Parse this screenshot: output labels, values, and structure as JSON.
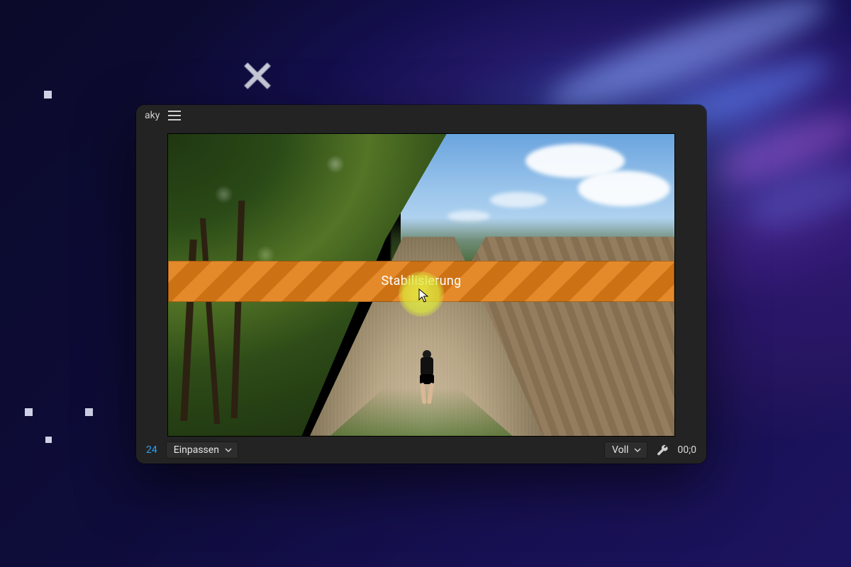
{
  "header": {
    "project_title_fragment": "aky"
  },
  "overlay": {
    "banner_text": "Stabilisierung"
  },
  "controls": {
    "timecode_left_fragment": "24",
    "fit_select": {
      "selected": "Einpassen"
    },
    "quality_select": {
      "selected": "Voll"
    },
    "timecode_right_fragment": "00;0"
  },
  "icons": {
    "hamburger": "hamburger-icon",
    "chevron_down": "chevron-down-icon",
    "wrench": "wrench-icon",
    "close": "close-icon",
    "cursor": "cursor-icon"
  },
  "colors": {
    "panel_bg": "#232323",
    "banner_orange_a": "#e48a2a",
    "banner_orange_b": "#cc7215",
    "timecode_blue": "#2aa3ff"
  }
}
